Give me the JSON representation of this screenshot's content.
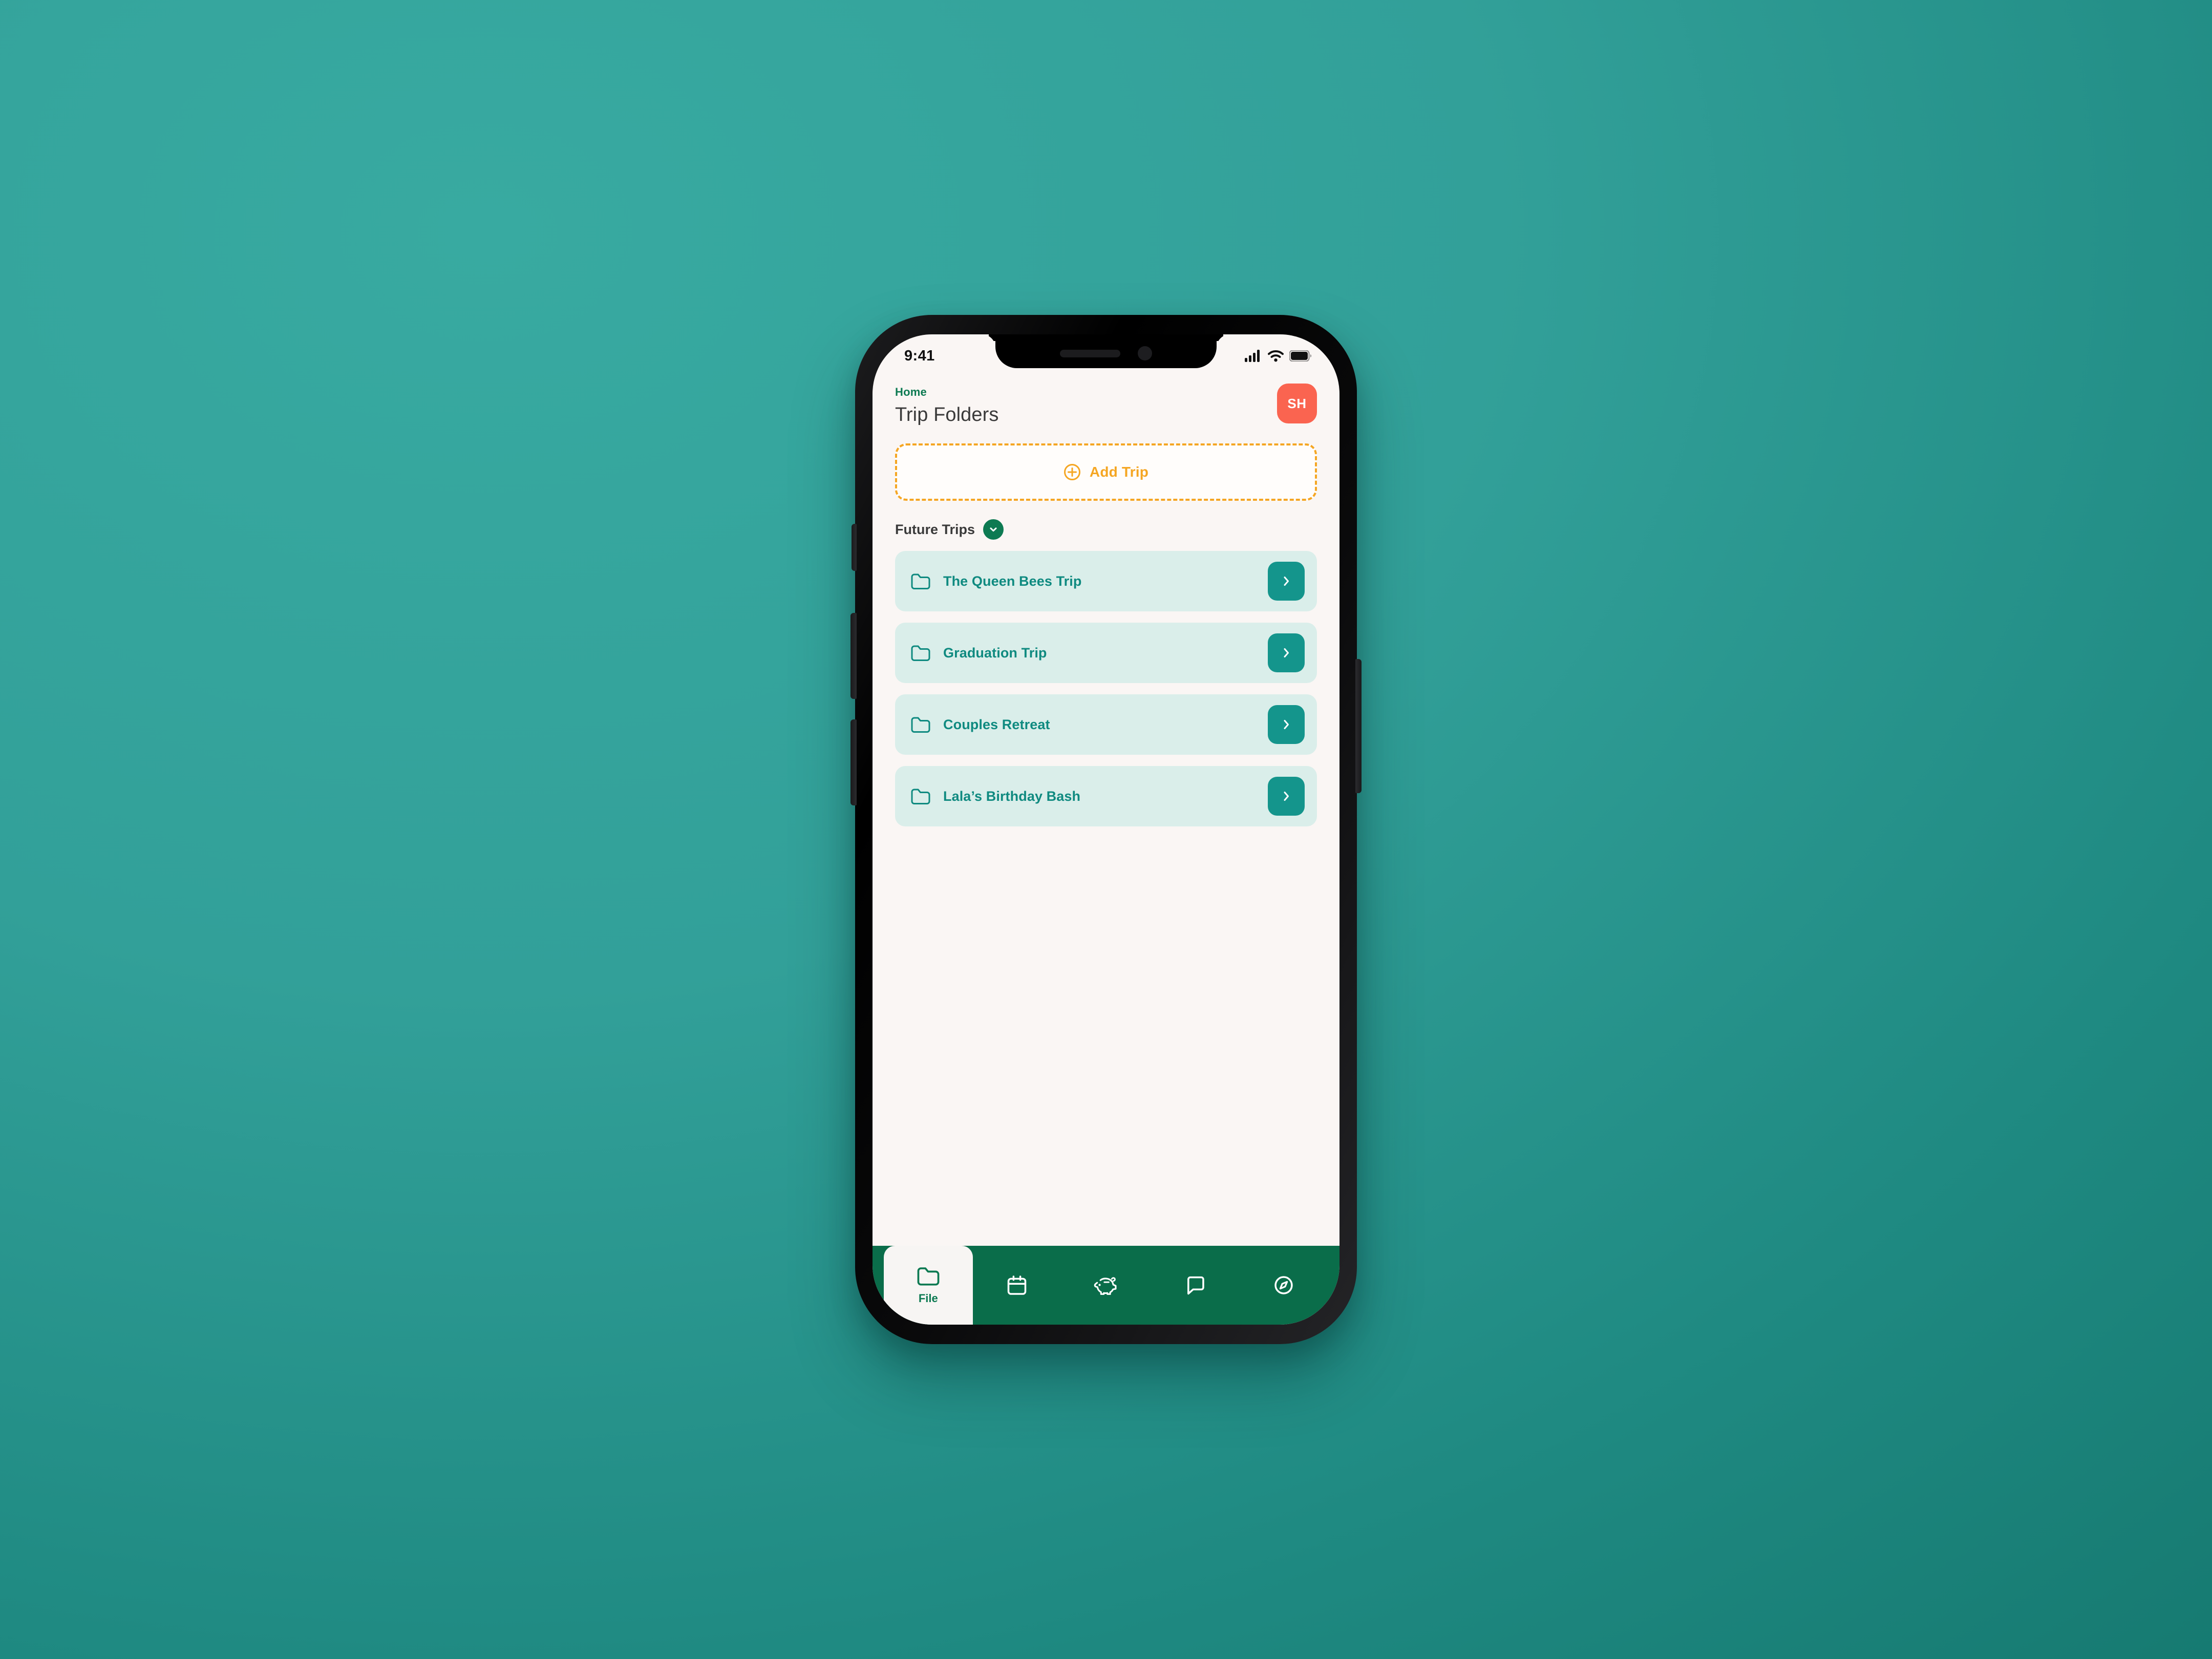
{
  "status_bar": {
    "time": "9:41",
    "signal_icon": "cellular-signal-icon",
    "wifi_icon": "wifi-icon",
    "battery_icon": "battery-icon"
  },
  "header": {
    "breadcrumb": "Home",
    "title": "Trip Folders",
    "avatar_initials": "SH",
    "avatar_color": "#fa6450"
  },
  "add_trip": {
    "label": "Add Trip",
    "icon": "plus-circle-icon",
    "accent_color": "#f5a623"
  },
  "section": {
    "title": "Future Trips",
    "toggle_icon": "chevron-down-icon",
    "toggle_color": "#0d7a52"
  },
  "trips": [
    {
      "label": "The Queen Bees Trip",
      "icon": "folder-icon",
      "go_icon": "chevron-right-icon"
    },
    {
      "label": "Graduation Trip",
      "icon": "folder-icon",
      "go_icon": "chevron-right-icon"
    },
    {
      "label": "Couples Retreat",
      "icon": "folder-icon",
      "go_icon": "chevron-right-icon"
    },
    {
      "label": "Lala’s Birthday Bash",
      "icon": "folder-icon",
      "go_icon": "chevron-right-icon"
    }
  ],
  "tab_bar": {
    "background_color": "#0a6d4a",
    "tabs": [
      {
        "label": "File",
        "icon": "folder-icon",
        "active": true
      },
      {
        "label": "",
        "icon": "calendar-icon",
        "active": false
      },
      {
        "label": "",
        "icon": "piggy-bank-icon",
        "active": false
      },
      {
        "label": "",
        "icon": "chat-bubble-icon",
        "active": false
      },
      {
        "label": "",
        "icon": "compass-icon",
        "active": false
      }
    ]
  },
  "theme": {
    "card_background": "#daeeea",
    "card_text": "#0f8a80",
    "go_button": "#14958c",
    "screen_background": "#faf6f4",
    "page_background_from": "#38aaa1",
    "page_background_to": "#15786f"
  }
}
